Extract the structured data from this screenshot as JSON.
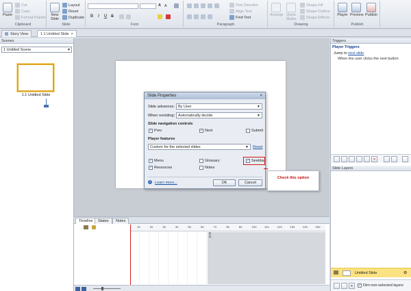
{
  "ribbon": {
    "clipboard": {
      "paste": "Paste",
      "cut": "Cut",
      "copy": "Copy",
      "format_painter": "Format Painter",
      "label": "Clipboard"
    },
    "slide": {
      "new_slide": "New Slide",
      "layout": "Layout",
      "reset": "Reset",
      "duplicate": "Duplicate",
      "label": "Slide"
    },
    "font": {
      "label": "Font",
      "size_up": "A",
      "size_down": "A",
      "bold": "B",
      "italic": "I",
      "underline": "U",
      "strike": "S"
    },
    "paragraph": {
      "text_direction": "Text Direction",
      "align_text": "Align Text",
      "find_text": "Find Text",
      "label": "Paragraph"
    },
    "drawing": {
      "arrange": "Arrange",
      "quick_styles": "Quick Styles",
      "shape_fill": "Shape Fill",
      "shape_outline": "Shape Outline",
      "shape_effects": "Shape Effects",
      "label": "Drawing"
    },
    "publish": {
      "player": "Player",
      "preview": "Preview",
      "publish": "Publish",
      "label": "Publish"
    }
  },
  "tabs": {
    "story_view": "Story View",
    "untitled_slide": "1.1 Untitled Slide",
    "close": "×"
  },
  "scenes": {
    "title": "Scenes",
    "selected": "1 Untitled Scene",
    "slide_caption": "1.1 Untitled Slide"
  },
  "triggers": {
    "title": "Triggers",
    "player_triggers": "Player Triggers",
    "jump_prefix": "Jump to",
    "jump_link": "next slide",
    "condition": "When the user clicks the next button"
  },
  "slide_layers": {
    "title": "Slide Layers",
    "layer_name": "Untitled Slide",
    "dim_label": "Dim non-selected layers"
  },
  "dialog": {
    "title": "Slide Properties",
    "close": "×",
    "slide_advances_label": "Slide advances:",
    "slide_advances_value": "By User",
    "when_revisiting_label": "When revisiting:",
    "when_revisiting_value": "Automatically decide",
    "nav_heading": "Slide navigation controls",
    "prev": "Prev",
    "next": "Next",
    "submit": "Submit",
    "player_heading": "Player features",
    "player_value": "Custom for the selected slides",
    "reset": "Reset",
    "menu": "Menu",
    "glossary": "Glossary",
    "seekbar": "Seekbar",
    "resources": "Resources",
    "notes": "Notes",
    "learn_more": "Learn more...",
    "ok": "OK",
    "cancel": "Cancel",
    "checked": {
      "prev": true,
      "next": true,
      "submit": false,
      "menu": true,
      "glossary": false,
      "seekbar": true,
      "resources": true,
      "notes": false
    }
  },
  "callout": {
    "text": "Check this option"
  },
  "timeline": {
    "tabs": [
      "Timeline",
      "States",
      "Notes"
    ],
    "ticks": [
      "1s",
      "2s",
      "3s",
      "4s",
      "5s",
      "6s",
      "7s",
      "8s",
      "9s",
      "10s",
      "11s",
      "12s",
      "13s",
      "14s",
      "15s"
    ],
    "end_label": "End"
  },
  "colors": {
    "accent": "#1a4fa0",
    "highlight": "#d01818",
    "layer_selected": "#fbe283"
  }
}
